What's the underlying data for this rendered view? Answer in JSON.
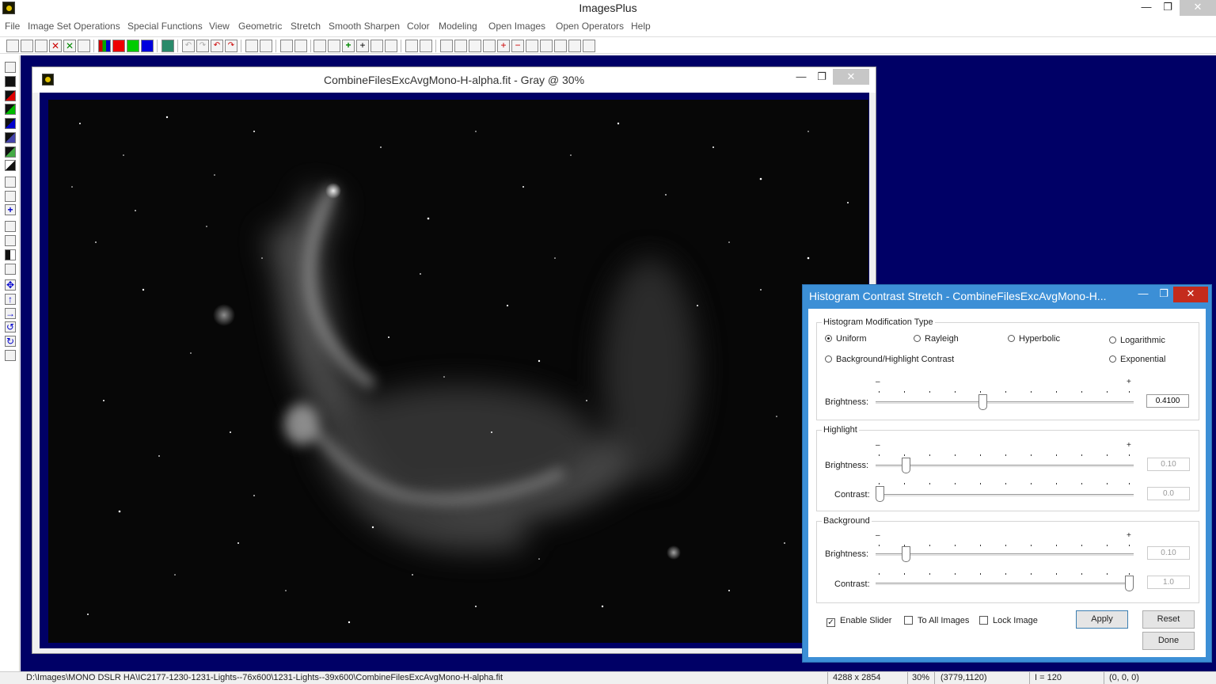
{
  "app": {
    "title": "ImagesPlus"
  },
  "menu": [
    "File",
    "Image Set Operations",
    "Special Functions",
    "View",
    "Geometric",
    "Stretch",
    "Smooth Sharpen",
    "Color",
    "Modeling",
    "Open Images",
    "Open Operators",
    "Help"
  ],
  "image_window": {
    "title": "CombineFilesExcAvgMono-H-alpha.fit - Gray @ 30%"
  },
  "dialog": {
    "title": "Histogram Contrast Stretch - CombineFilesExcAvgMono-H...",
    "modification": {
      "label": "Histogram Modification Type",
      "options": [
        "Uniform",
        "Rayleigh",
        "Hyperbolic",
        "Logarithmic",
        "Background/Highlight Contrast",
        "Exponential"
      ],
      "selected": "Uniform",
      "brightness_label": "Brightness:",
      "brightness_value": "0.4100"
    },
    "highlight": {
      "label": "Highlight",
      "brightness_label": "Brightness:",
      "brightness_value": "0.10",
      "contrast_label": "Contrast:",
      "contrast_value": "0.0"
    },
    "background": {
      "label": "Background",
      "brightness_label": "Brightness:",
      "brightness_value": "0.10",
      "contrast_label": "Contrast:",
      "contrast_value": "1.0"
    },
    "minus": "–",
    "plus": "+",
    "checks": {
      "enable_slider": "Enable Slider",
      "to_all_images": "To All Images",
      "lock_image": "Lock Image"
    },
    "enable_slider_checked": true,
    "buttons": {
      "apply": "Apply",
      "reset": "Reset",
      "done": "Done"
    }
  },
  "status": {
    "path": "D:\\Images\\MONO DSLR HA\\IC2177-1230-1231-Lights--76x600\\1231-Lights--39x600\\CombineFilesExcAvgMono-H-alpha.fit",
    "dimensions": "4288 x 2854",
    "zoom": "30%",
    "coords": "(3779,1120)",
    "intensity": "I = 120",
    "rgb": "(0, 0, 0)"
  }
}
